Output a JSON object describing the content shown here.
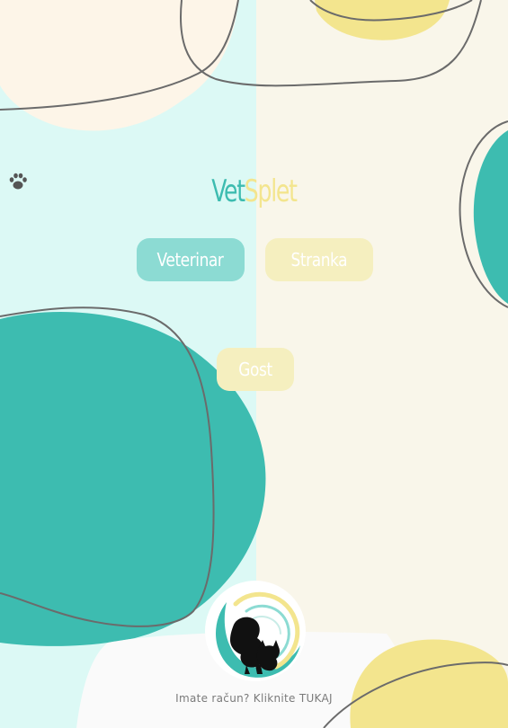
{
  "brand": {
    "part1": "Vet",
    "part2": "Splet"
  },
  "buttons": {
    "veterinar": "Veterinar",
    "stranka": "Stranka",
    "gost": "Gost"
  },
  "footer": {
    "text": "Imate račun? Kliknite ",
    "link": "TUKAJ"
  },
  "colors": {
    "teal": "#3dbcb0",
    "light_teal": "#8cdbd3",
    "yellow": "#f3e58e",
    "pale_yellow": "#f5efbf",
    "mint_bg": "#dcf9f5",
    "cream_bg": "#f9f6ea",
    "outline": "#6b6b6b"
  },
  "icons": {
    "paw": "paw-icon",
    "logo": "dog-cat-logo-icon"
  }
}
